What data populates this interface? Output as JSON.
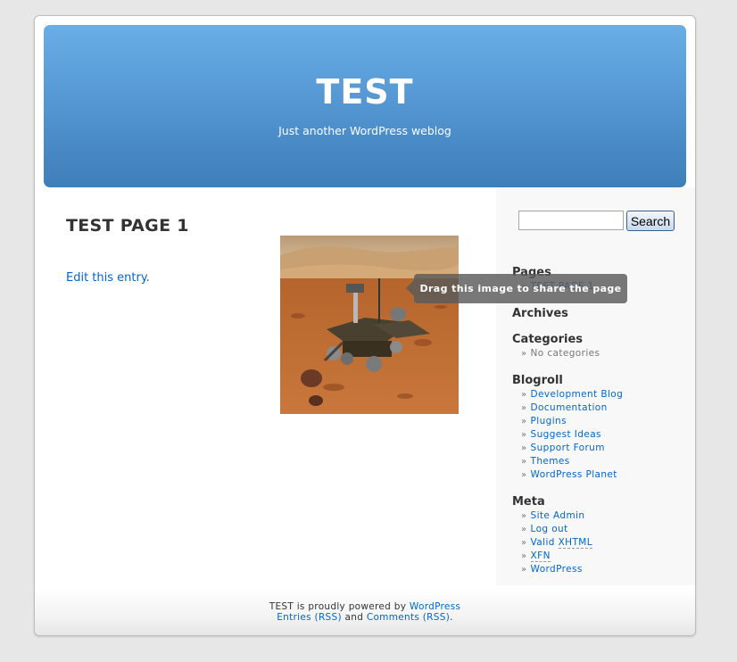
{
  "header": {
    "blog_title": "TEST",
    "blog_description": "Just another WordPress weblog"
  },
  "post": {
    "title": "TEST PAGE 1",
    "edit_link": "Edit this entry.",
    "image_alt": "Mars rover on red rocky terrain"
  },
  "sidebar": {
    "search": {
      "value": "",
      "button_label": "Search"
    },
    "bullet": "»",
    "pages": {
      "title": "Pages",
      "items": [
        "TEST PAGE 1"
      ]
    },
    "archives": {
      "title": "Archives"
    },
    "categories": {
      "title": "Categories",
      "items": [
        "No categories"
      ]
    },
    "blogroll": {
      "title": "Blogroll",
      "items": [
        "Development Blog",
        "Documentation",
        "Plugins",
        "Suggest Ideas",
        "Support Forum",
        "Themes",
        "WordPress Planet"
      ]
    },
    "meta": {
      "title": "Meta",
      "items": [
        "Site Admin",
        "Log out",
        "Valid ",
        "XFN",
        "WordPress"
      ],
      "xhtml_abbr": "XHTML"
    }
  },
  "footer": {
    "powered_prefix": "TEST is proudly powered by ",
    "powered_link": "WordPress",
    "entries_rss": "Entries (RSS)",
    "and": " and ",
    "comments_rss": "Comments (RSS)",
    "period": "."
  },
  "tooltip": {
    "text": "Drag this image to share the page"
  },
  "colors": {
    "link": "#0066cc",
    "header_top": "#69aee7",
    "header_bottom": "#3f7fb9",
    "sidebar_bg": "#f8f8f8"
  }
}
